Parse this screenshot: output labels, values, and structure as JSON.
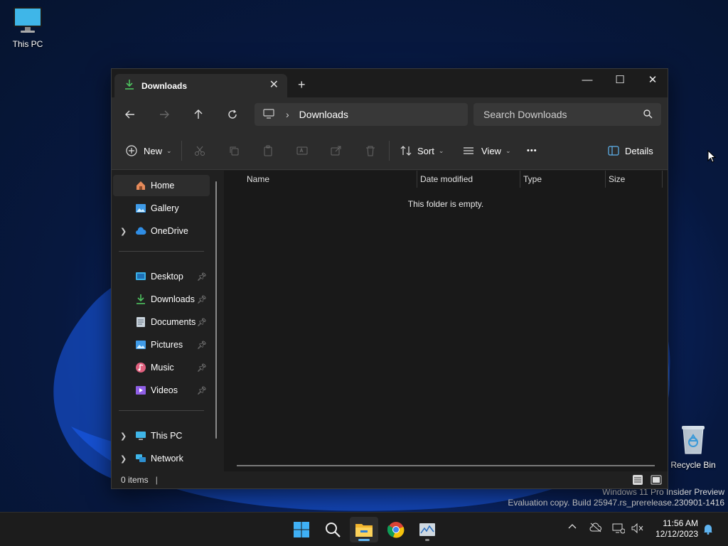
{
  "desktop": {
    "icons": [
      {
        "label": "This PC"
      },
      {
        "label": "Recycle Bin"
      }
    ],
    "watermark": {
      "line1": "Windows 11 Pro Insider Preview",
      "line2": "Evaluation copy. Build 25947.rs_prerelease.230901-1416"
    }
  },
  "window": {
    "tab": {
      "title": "Downloads",
      "close": "✕"
    },
    "new_tab": "+",
    "controls": {
      "minimize": "—",
      "maximize": "☐",
      "close": "✕"
    },
    "address": {
      "separator": "›",
      "location": "Downloads"
    },
    "search": {
      "placeholder": "Search Downloads"
    },
    "commands": {
      "new": "New",
      "sort": "Sort",
      "view": "View",
      "more": "•••",
      "details": "Details"
    },
    "sidebar": {
      "items": [
        {
          "label": "Home",
          "icon": "home-icon",
          "active": true
        },
        {
          "label": "Gallery",
          "icon": "gallery-icon"
        },
        {
          "label": "OneDrive",
          "icon": "cloud-icon",
          "expandable": true
        },
        {
          "label": "Desktop",
          "icon": "desktop-folder-icon",
          "pinned": true
        },
        {
          "label": "Downloads",
          "icon": "downloads-folder-icon",
          "pinned": true
        },
        {
          "label": "Documents",
          "icon": "documents-folder-icon",
          "pinned": true
        },
        {
          "label": "Pictures",
          "icon": "pictures-folder-icon",
          "pinned": true
        },
        {
          "label": "Music",
          "icon": "music-folder-icon",
          "pinned": true
        },
        {
          "label": "Videos",
          "icon": "videos-folder-icon",
          "pinned": true
        },
        {
          "label": "This PC",
          "icon": "computer-icon",
          "expandable": true
        },
        {
          "label": "Network",
          "icon": "network-icon",
          "expandable": true
        }
      ]
    },
    "columns": [
      "Name",
      "Date modified",
      "Type",
      "Size"
    ],
    "empty_message": "This folder is empty.",
    "status": {
      "item_count": "0 items"
    }
  },
  "taskbar": {
    "apps": [
      "start-icon",
      "search-icon",
      "file-explorer-icon",
      "chrome-icon",
      "performance-monitor-icon"
    ],
    "clock": {
      "time": "11:56 AM",
      "date": "12/12/2023"
    }
  },
  "colors": {
    "accent": "#60b8f5",
    "window_bg": "#202020",
    "content_bg": "#191919"
  }
}
